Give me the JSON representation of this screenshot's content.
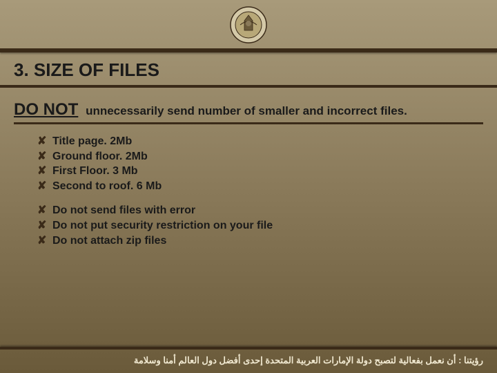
{
  "header": {
    "logo_alt": "emblem-logo"
  },
  "title": "3. SIZE OF FILES",
  "lead": {
    "prefix": "DO NOT",
    "rest": "unnecessarily send number of smaller and incorrect files."
  },
  "group1": [
    "Title page. 2Mb",
    "Ground floor. 2Mb",
    "First Floor. 3 Mb",
    "Second to roof. 6 Mb"
  ],
  "group2": [
    "Do not send files with error",
    "Do not put security restriction on your file",
    "Do not attach zip files"
  ],
  "footer": "رؤيتنا : أن نعمل بفعالية لتصبح دولة الإمارات العربية المتحدة إحدى أفضل دول العالم أمنا وسلامة"
}
